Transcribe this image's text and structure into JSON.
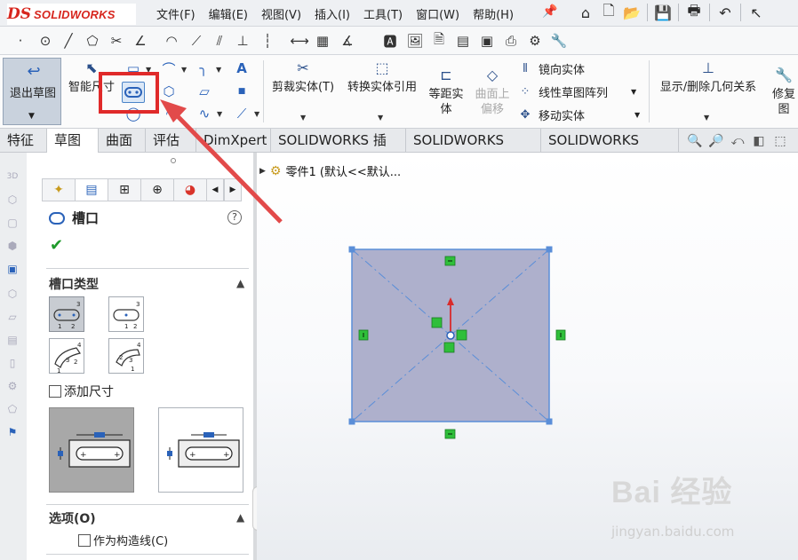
{
  "app": {
    "logo_ds": "DS",
    "logo_text": "SOLIDWORKS"
  },
  "menu": [
    "文件(F)",
    "编辑(E)",
    "视图(V)",
    "插入(I)",
    "工具(T)",
    "窗口(W)",
    "帮助(H)"
  ],
  "command_manager": {
    "exit_sketch": "退出草图",
    "smart_dimension": "智能尺寸",
    "trim": "剪裁实体(T)",
    "convert": "转换实体引用",
    "offset_line1": "等距实",
    "offset_line2": "体",
    "offset_surface_line1": "曲面上",
    "offset_surface_line2": "偏移",
    "mirror": "镜向实体",
    "linear_pattern": "线性草图阵列",
    "move": "移动实体",
    "relations": "显示/删除几何关系",
    "repair_line1": "修复",
    "repair_line2": "图"
  },
  "tabs": [
    "特征",
    "草图",
    "曲面",
    "评估",
    "DimXpert",
    "SOLIDWORKS 插件",
    "SOLIDWORKS MBD",
    "SOLIDWORKS CAM"
  ],
  "active_tab": "草图",
  "property_manager": {
    "title": "槽口",
    "help": "?",
    "section_slot_type": "槽口类型",
    "add_dimension": "添加尺寸",
    "section_options": "选项(O)",
    "construction": "作为构造线(C)"
  },
  "feature_tree": {
    "root": "零件1  (默认<<默认..."
  },
  "watermark": {
    "brand": "Bai  经验",
    "url": "jingyan.baidu.com"
  },
  "colors": {
    "accent": "#2a62b9",
    "highlight": "#e02a2a",
    "rect_fill": "#aeb0cc"
  }
}
